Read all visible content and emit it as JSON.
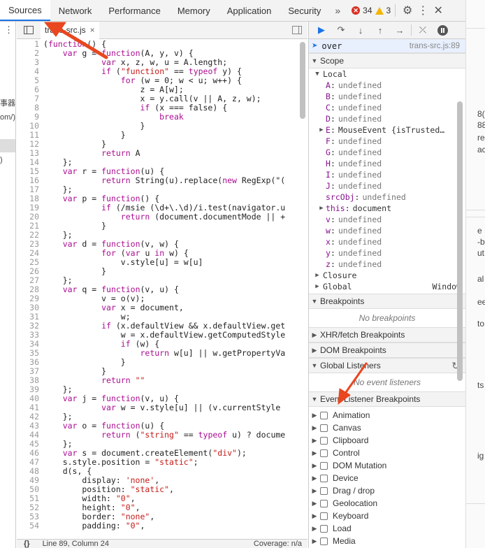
{
  "topbar": {
    "tabs": [
      "Sources",
      "Network",
      "Performance",
      "Memory",
      "Application",
      "Security"
    ],
    "more": "»",
    "errors": "34",
    "warnings": "3",
    "settings_icon": "gear-icon",
    "menu_icon": "kebab-icon",
    "close": "✕"
  },
  "navigator": {
    "fragments": [
      "事器",
      "om/)",
      ")"
    ]
  },
  "editor": {
    "file_name": "trans-src.js",
    "close_glyph": "×",
    "lines": [
      {
        "n": "1",
        "t": "(function() {"
      },
      {
        "n": "2",
        "t": "    var g = function(A, y, v) {"
      },
      {
        "n": "3",
        "t": "            var x, z, w, u = A.length;"
      },
      {
        "n": "4",
        "t": "            if (\"function\" == typeof y) {"
      },
      {
        "n": "5",
        "t": "                for (w = 0; w < u; w++) {"
      },
      {
        "n": "6",
        "t": "                    z = A[w];"
      },
      {
        "n": "7",
        "t": "                    x = y.call(v || A, z, w);"
      },
      {
        "n": "8",
        "t": "                    if (x === false) {"
      },
      {
        "n": "9",
        "t": "                        break"
      },
      {
        "n": "10",
        "t": "                    }"
      },
      {
        "n": "11",
        "t": "                }"
      },
      {
        "n": "12",
        "t": "            }"
      },
      {
        "n": "13",
        "t": "            return A"
      },
      {
        "n": "14",
        "t": "    };"
      },
      {
        "n": "15",
        "t": "    var r = function(u) {"
      },
      {
        "n": "16",
        "t": "            return String(u).replace(new RegExp(\"("
      },
      {
        "n": "17",
        "t": "    };"
      },
      {
        "n": "18",
        "t": "    var p = function() {"
      },
      {
        "n": "19",
        "t": "            if (/msie (\\d+\\.\\d)/i.test(navigator.u"
      },
      {
        "n": "20",
        "t": "                return (document.documentMode || +"
      },
      {
        "n": "21",
        "t": "            }"
      },
      {
        "n": "22",
        "t": "    };"
      },
      {
        "n": "23",
        "t": "    var d = function(v, w) {"
      },
      {
        "n": "24",
        "t": "            for (var u in w) {"
      },
      {
        "n": "25",
        "t": "                v.style[u] = w[u]"
      },
      {
        "n": "26",
        "t": "            }"
      },
      {
        "n": "27",
        "t": "    };"
      },
      {
        "n": "28",
        "t": "    var q = function(v, u) {"
      },
      {
        "n": "29",
        "t": "            v = o(v);"
      },
      {
        "n": "30",
        "t": "            var x = document,"
      },
      {
        "n": "31",
        "t": "                w;"
      },
      {
        "n": "32",
        "t": "            if (x.defaultView && x.defaultView.get"
      },
      {
        "n": "33",
        "t": "                w = x.defaultView.getComputedStyle"
      },
      {
        "n": "34",
        "t": "                if (w) {"
      },
      {
        "n": "35",
        "t": "                    return w[u] || w.getPropertyVa"
      },
      {
        "n": "36",
        "t": "                }"
      },
      {
        "n": "37",
        "t": "            }"
      },
      {
        "n": "38",
        "t": "            return \"\""
      },
      {
        "n": "39",
        "t": "    };"
      },
      {
        "n": "40",
        "t": "    var j = function(v, u) {"
      },
      {
        "n": "41",
        "t": "            var w = v.style[u] || (v.currentStyle"
      },
      {
        "n": "42",
        "t": "    };"
      },
      {
        "n": "43",
        "t": "    var o = function(u) {"
      },
      {
        "n": "44",
        "t": "            return (\"string\" == typeof u) ? docume"
      },
      {
        "n": "45",
        "t": "    };"
      },
      {
        "n": "46",
        "t": "    var s = document.createElement(\"div\");"
      },
      {
        "n": "47",
        "t": "    s.style.position = \"static\";"
      },
      {
        "n": "48",
        "t": "    d(s, {"
      },
      {
        "n": "49",
        "t": "        display: 'none',"
      },
      {
        "n": "50",
        "t": "        position: \"static\","
      },
      {
        "n": "51",
        "t": "        width: \"0\","
      },
      {
        "n": "52",
        "t": "        height: \"0\","
      },
      {
        "n": "53",
        "t": "        border: \"none\","
      },
      {
        "n": "54",
        "t": "        padding: \"0\","
      }
    ],
    "status_braces": "{}",
    "status_position": "Line 89, Column 24",
    "status_coverage": "Coverage: n/a"
  },
  "debugger": {
    "toolbar_icons": [
      "resume-icon",
      "step-over-icon",
      "step-into-icon",
      "step-out-icon",
      "step-icon",
      "deactivate-breakpoints-icon",
      "pause-on-exceptions-icon"
    ],
    "call_frame": {
      "name": "over",
      "location": "trans-src.js:89"
    },
    "scope_label": "Scope",
    "local_label": "Local",
    "locals": [
      {
        "name": "A",
        "value": "undefined",
        "expandable": false
      },
      {
        "name": "B",
        "value": "undefined",
        "expandable": false
      },
      {
        "name": "C",
        "value": "undefined",
        "expandable": false
      },
      {
        "name": "D",
        "value": "undefined",
        "expandable": false
      },
      {
        "name": "E",
        "value": "MouseEvent {isTrusted…",
        "expandable": true
      },
      {
        "name": "F",
        "value": "undefined",
        "expandable": false
      },
      {
        "name": "G",
        "value": "undefined",
        "expandable": false
      },
      {
        "name": "H",
        "value": "undefined",
        "expandable": false
      },
      {
        "name": "I",
        "value": "undefined",
        "expandable": false
      },
      {
        "name": "J",
        "value": "undefined",
        "expandable": false
      },
      {
        "name": "srcObj",
        "value": "undefined",
        "expandable": false
      },
      {
        "name": "this",
        "value": "document",
        "expandable": true
      },
      {
        "name": "v",
        "value": "undefined",
        "expandable": false
      },
      {
        "name": "w",
        "value": "undefined",
        "expandable": false
      },
      {
        "name": "x",
        "value": "undefined",
        "expandable": false
      },
      {
        "name": "y",
        "value": "undefined",
        "expandable": false
      },
      {
        "name": "z",
        "value": "undefined",
        "expandable": false
      }
    ],
    "closure_label": "Closure",
    "global_label": "Global",
    "global_value": "Window",
    "breakpoints_label": "Breakpoints",
    "no_breakpoints": "No breakpoints",
    "xhr_label": "XHR/fetch Breakpoints",
    "dom_label": "DOM Breakpoints",
    "global_listeners_label": "Global Listeners",
    "no_listeners": "No event listeners",
    "event_listener_label": "Event Listener Breakpoints",
    "event_categories": [
      "Animation",
      "Canvas",
      "Clipboard",
      "Control",
      "DOM Mutation",
      "Device",
      "Drag / drop",
      "Geolocation",
      "Keyboard",
      "Load",
      "Media"
    ]
  },
  "right_strip": {
    "fragments": [
      "8(",
      "88",
      "re",
      "ac",
      "e",
      "-b",
      "ut",
      "al",
      "ee",
      "to",
      "ts",
      "ig"
    ]
  },
  "colors": {
    "accent": "#1a73e8",
    "annotation_arrow": "#e8471f"
  }
}
